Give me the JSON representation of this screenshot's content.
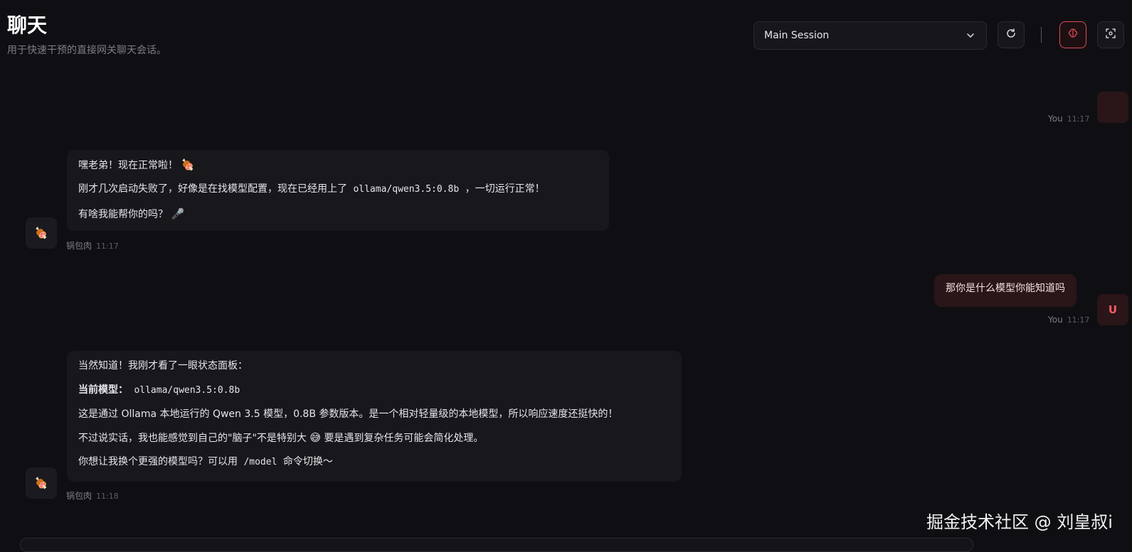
{
  "header": {
    "title": "聊天",
    "subtitle": "用于快速干预的直接网关聊天会话。"
  },
  "toolbar": {
    "session_value": "Main Session",
    "icons": {
      "refresh": "refresh-icon",
      "thinking": "brain-icon",
      "focus": "focus-icon",
      "chevron": "chevron-down-icon"
    },
    "accent_color": "#e24a56"
  },
  "messages": [
    {
      "role": "user",
      "sender": "You",
      "time": "11:17"
    },
    {
      "role": "assistant",
      "sender": "锅包肉",
      "time": "11:17",
      "avatar": "🍖",
      "line1": "嘿老弟！现在正常啦！",
      "line1_emoji": "🍖",
      "line2_before": "刚才几次启动失败了，好像是在找模型配置，现在已经用上了",
      "line2_code": "ollama/qwen3.5:0.8b",
      "line2_after": "，一切运行正常！",
      "line3": "有啥我能帮你的吗？",
      "line3_emoji": "🎤"
    },
    {
      "role": "user",
      "sender": "You",
      "time": "11:17",
      "avatar": "U",
      "text": "那你是什么模型你能知道吗"
    },
    {
      "role": "assistant",
      "sender": "锅包肉",
      "time": "11:18",
      "avatar": "🍖",
      "line1": "当然知道！我刚才看了一眼状态面板：",
      "line2_label": "当前模型：",
      "line2_code": "ollama/qwen3.5:0.8b",
      "line3": "这是通过 Ollama 本地运行的 Qwen 3.5 模型，0.8B 参数版本。是一个相对轻量级的本地模型，所以响应速度还挺快的！",
      "line4_before": "不过说实话，我也能感觉到自己的\"脑子\"不是特别大",
      "line4_emoji": "😅",
      "line4_after": "要是遇到复杂任务可能会简化处理。",
      "line5_before": "你想让我换个更强的模型吗？可以用",
      "line5_code": "/model",
      "line5_after": "命令切换～"
    }
  ],
  "watermark": "掘金技术社区 @ 刘皇叔i"
}
